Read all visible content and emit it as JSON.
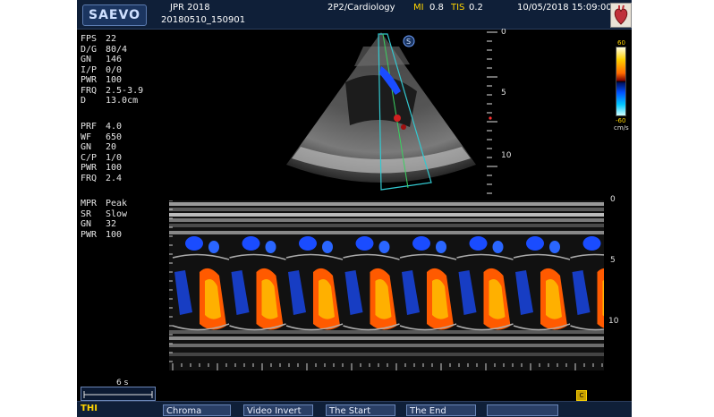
{
  "header": {
    "brand": "SAEVO",
    "institution": "JPR 2018",
    "study_id": "20180510_150901",
    "probe_preset": "2P2/Cardiology",
    "mi_label": "MI",
    "mi_value": "0.8",
    "tis_label": "TIS",
    "tis_value": "0.2",
    "datetime": "10/05/2018 15:09:00"
  },
  "bmode_params": [
    {
      "label": "FPS",
      "value": "22"
    },
    {
      "label": "D/G",
      "value": "80/4"
    },
    {
      "label": "GN",
      "value": "146"
    },
    {
      "label": "I/P",
      "value": "0/0"
    },
    {
      "label": "PWR",
      "value": "100"
    },
    {
      "label": "FRQ",
      "value": "2.5-3.9"
    },
    {
      "label": "D",
      "value": "13.0cm"
    }
  ],
  "color_params": [
    {
      "label": "PRF",
      "value": "4.0"
    },
    {
      "label": "WF",
      "value": "650"
    },
    {
      "label": "GN",
      "value": "20"
    },
    {
      "label": "C/P",
      "value": "1/0"
    },
    {
      "label": "PWR",
      "value": "100"
    },
    {
      "label": "FRQ",
      "value": "2.4"
    }
  ],
  "mmode_params": [
    {
      "label": "MPR",
      "value": "Peak"
    },
    {
      "label": "SR",
      "value": "Slow"
    },
    {
      "label": "GN",
      "value": "32"
    },
    {
      "label": "PWR",
      "value": "100"
    }
  ],
  "bmode_depth_labels": [
    "0",
    "5",
    "10"
  ],
  "mmode_depth_labels": [
    "0",
    "5",
    "10"
  ],
  "color_scale": {
    "max": "60",
    "min": "-60",
    "unit": "cm/s"
  },
  "time_scale_label": "6 s",
  "mode_label": "THI",
  "softkeys": [
    "Chroma",
    "Video Invert",
    "The Start",
    "The End"
  ],
  "colors": {
    "header_bg": "#0f1f38",
    "highlight_yellow": "#ffd400",
    "button_bg": "#2a3f66",
    "flow_red": "#ff5a00",
    "flow_blue": "#1a4cff",
    "roi_cyan": "#33c8d0"
  }
}
